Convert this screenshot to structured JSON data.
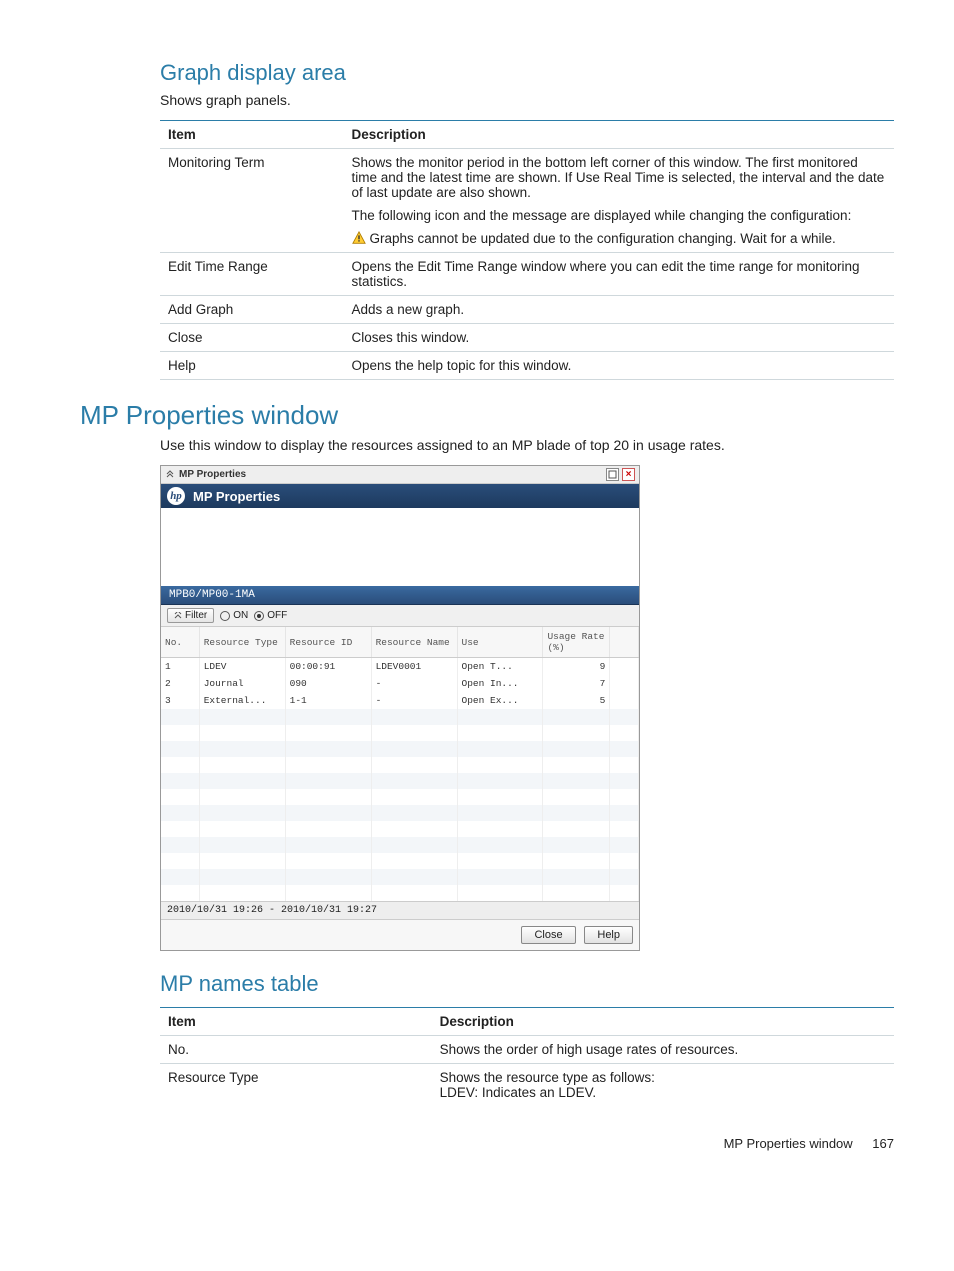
{
  "sections": {
    "graph_area": {
      "heading": "Graph display area",
      "intro": "Shows graph panels.",
      "table": {
        "headers": [
          "Item",
          "Description"
        ],
        "rows": [
          {
            "item": "Monitoring Term",
            "desc_p1": "Shows the monitor period in the bottom left corner of this window. The first monitored time and the latest time are shown. If Use Real Time is selected, the interval and the date of last update are also shown.",
            "desc_p2": "The following icon and the message are displayed while changing the configuration:",
            "desc_warn": "Graphs cannot be updated due to the configuration changing. Wait for a while."
          },
          {
            "item": "Edit Time Range",
            "desc": "Opens the Edit Time Range window where you can edit the time range for monitoring statistics."
          },
          {
            "item": "Add Graph",
            "desc": "Adds a new graph."
          },
          {
            "item": "Close",
            "desc": "Closes this window."
          },
          {
            "item": "Help",
            "desc": "Opens the help topic for this window."
          }
        ]
      }
    },
    "mp_props": {
      "heading": "MP Properties window",
      "intro": "Use this window to display the resources assigned to an MP blade of top 20 in usage rates."
    },
    "mp_names": {
      "heading": "MP names table",
      "table": {
        "headers": [
          "Item",
          "Description"
        ],
        "rows": [
          {
            "item": "No.",
            "desc": "Shows the order of high usage rates of resources."
          },
          {
            "item": "Resource Type",
            "desc_l1": "Shows the resource type as follows:",
            "desc_l2": "LDEV: Indicates an LDEV."
          }
        ]
      }
    }
  },
  "screenshot": {
    "titlebar": {
      "label": "MP Properties"
    },
    "header": {
      "logo": "hp",
      "title": "MP Properties"
    },
    "tab": "MPB0/MP00-1MA",
    "filter": {
      "button": "Filter",
      "on": "ON",
      "off": "OFF"
    },
    "columns": [
      "No.",
      "Resource Type",
      "Resource ID",
      "Resource Name",
      "Use",
      "Usage Rate (%)"
    ],
    "rows": [
      {
        "no": "1",
        "type": "LDEV",
        "id": "00:00:91",
        "name": "LDEV0001",
        "use": "Open T...",
        "rate": "9"
      },
      {
        "no": "2",
        "type": "Journal",
        "id": "090",
        "name": "-",
        "use": "Open In...",
        "rate": "7"
      },
      {
        "no": "3",
        "type": "External...",
        "id": "1-1",
        "name": "-",
        "use": "Open Ex...",
        "rate": "5"
      }
    ],
    "status": "2010/10/31 19:26 - 2010/10/31 19:27",
    "buttons": {
      "close": "Close",
      "help": "Help"
    }
  },
  "footer": {
    "text": "MP Properties window",
    "page": "167"
  }
}
